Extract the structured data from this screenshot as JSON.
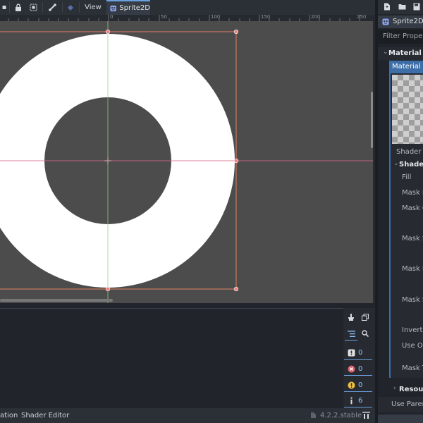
{
  "toolbar": {
    "view_label": "View",
    "tab_label": "Sprite2D",
    "ruler_ticks": [
      "0",
      "50",
      "100",
      "150",
      "200",
      "250"
    ]
  },
  "bottom_counters": {
    "errors_info": "0",
    "errors": "0",
    "warnings": "0",
    "messages": "6"
  },
  "statusbar": {
    "tab_animation": "ation",
    "tab_shader_editor": "Shader Editor",
    "version": "4.2.2.stable"
  },
  "inspector": {
    "node_name": "Sprite2D",
    "filter_placeholder": "Filter Propert",
    "section_material": "Material",
    "material_property": "Material",
    "shader_label": "Shader",
    "shader_params_label": "Shader F",
    "params": [
      "Fill",
      "Mask Ro",
      "Mask Of",
      "Mask Siz",
      "Mask Ro",
      "Mask Sc",
      "Invert M",
      "Use Oth",
      "Mask Te"
    ],
    "resource_label": "Resourc",
    "use_parent_label": "Use Paren"
  },
  "colors": {
    "accent": "#6aa0e0",
    "viewport_bg": "#4c4c4c",
    "selection": "#e08060"
  }
}
